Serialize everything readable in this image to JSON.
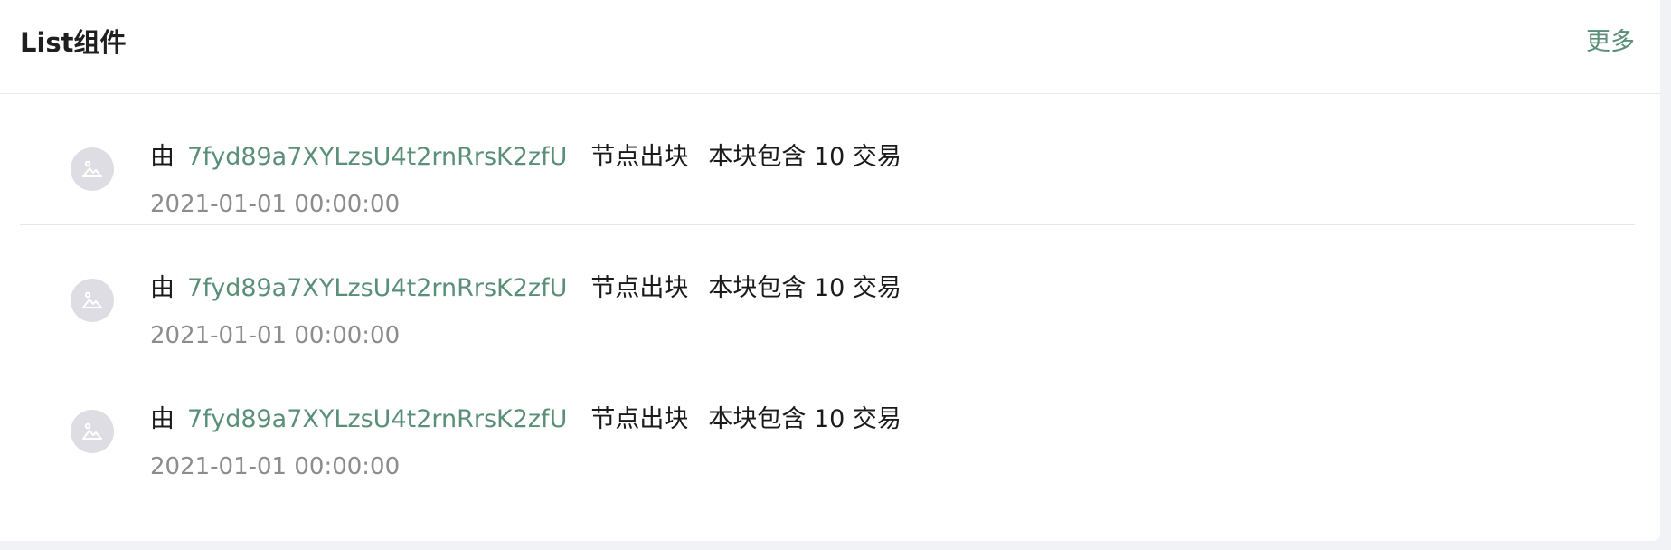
{
  "card": {
    "title": "List组件",
    "more_label": "更多"
  },
  "list": {
    "items": [
      {
        "prefix": "由",
        "node_id": "7fyd89a7XYLzsU4t2rnRrsK2zfU",
        "action": "节点出块",
        "detail": "本块包含 10 交易",
        "timestamp": "2021-01-01 00:00:00",
        "avatar_icon": "image-placeholder-icon"
      },
      {
        "prefix": "由",
        "node_id": "7fyd89a7XYLzsU4t2rnRrsK2zfU",
        "action": "节点出块",
        "detail": "本块包含 10 交易",
        "timestamp": "2021-01-01 00:00:00",
        "avatar_icon": "image-placeholder-icon"
      },
      {
        "prefix": "由",
        "node_id": "7fyd89a7XYLzsU4t2rnRrsK2zfU",
        "action": "节点出块",
        "detail": "本块包含 10 交易",
        "timestamp": "2021-01-01 00:00:00",
        "avatar_icon": "image-placeholder-icon"
      }
    ]
  },
  "colors": {
    "accent": "#5a8f77",
    "avatar_bg": "#dedde4",
    "muted_text": "#8c8c8c",
    "divider": "#e8e8e8"
  }
}
